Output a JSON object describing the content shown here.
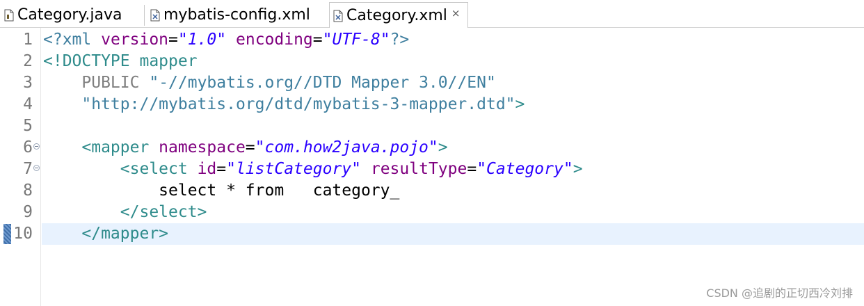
{
  "tabs": [
    {
      "label": "Category.java",
      "icon": "java-file-icon"
    },
    {
      "label": "mybatis-config.xml",
      "icon": "xml-file-icon"
    },
    {
      "label": "Category.xml",
      "icon": "xml-file-icon",
      "active": true,
      "close": "×"
    }
  ],
  "editor": {
    "current_line": 10,
    "lines": [
      {
        "num": "1",
        "tokens": [
          {
            "t": "pi",
            "v": "<?xml "
          },
          {
            "t": "attr",
            "v": "version"
          },
          {
            "t": "text",
            "v": "="
          },
          {
            "t": "val",
            "v": "\"1.0\""
          },
          {
            "t": "text",
            "v": " "
          },
          {
            "t": "attr",
            "v": "encoding"
          },
          {
            "t": "text",
            "v": "="
          },
          {
            "t": "val",
            "v": "\"UTF-8\""
          },
          {
            "t": "pi",
            "v": "?>"
          }
        ]
      },
      {
        "num": "2",
        "tokens": [
          {
            "t": "doctype",
            "v": "<!DOCTYPE mapper"
          }
        ]
      },
      {
        "num": "3",
        "tokens": [
          {
            "t": "text",
            "v": "    "
          },
          {
            "t": "pub",
            "v": "PUBLIC"
          },
          {
            "t": "text",
            "v": " "
          },
          {
            "t": "dtdstr",
            "v": "\"-//mybatis.org//DTD Mapper 3.0//EN\""
          }
        ]
      },
      {
        "num": "4",
        "tokens": [
          {
            "t": "text",
            "v": "    "
          },
          {
            "t": "dtdstr",
            "v": "\"http://mybatis.org/dtd/mybatis-3-mapper.dtd\""
          },
          {
            "t": "doctype",
            "v": ">"
          }
        ]
      },
      {
        "num": "5",
        "tokens": []
      },
      {
        "num": "6",
        "fold": true,
        "tokens": [
          {
            "t": "text",
            "v": "    "
          },
          {
            "t": "tag",
            "v": "<mapper "
          },
          {
            "t": "attr",
            "v": "namespace"
          },
          {
            "t": "text",
            "v": "="
          },
          {
            "t": "val",
            "v": "\"com.how2java.pojo\""
          },
          {
            "t": "tag",
            "v": ">"
          }
        ]
      },
      {
        "num": "7",
        "fold": true,
        "tokens": [
          {
            "t": "text",
            "v": "        "
          },
          {
            "t": "tag",
            "v": "<select "
          },
          {
            "t": "attr",
            "v": "id"
          },
          {
            "t": "text",
            "v": "="
          },
          {
            "t": "val",
            "v": "\"listCategory\""
          },
          {
            "t": "text",
            "v": " "
          },
          {
            "t": "attr",
            "v": "resultType"
          },
          {
            "t": "text",
            "v": "="
          },
          {
            "t": "val",
            "v": "\"Category\""
          },
          {
            "t": "tag",
            "v": ">"
          }
        ]
      },
      {
        "num": "8",
        "tokens": [
          {
            "t": "text",
            "v": "            select * from   category_"
          }
        ]
      },
      {
        "num": "9",
        "tokens": [
          {
            "t": "text",
            "v": "        "
          },
          {
            "t": "tag",
            "v": "</select>"
          }
        ]
      },
      {
        "num": "10",
        "tokens": [
          {
            "t": "text",
            "v": "    "
          },
          {
            "t": "tag",
            "v": "</mapper>"
          }
        ]
      }
    ]
  },
  "watermark": "CSDN @追剧的正切西冷刘排",
  "colors": {
    "tag": "#2e8b8b",
    "attribute": "#7f007f",
    "value": "#2a00ff",
    "current_line": "#e8f2fe"
  }
}
